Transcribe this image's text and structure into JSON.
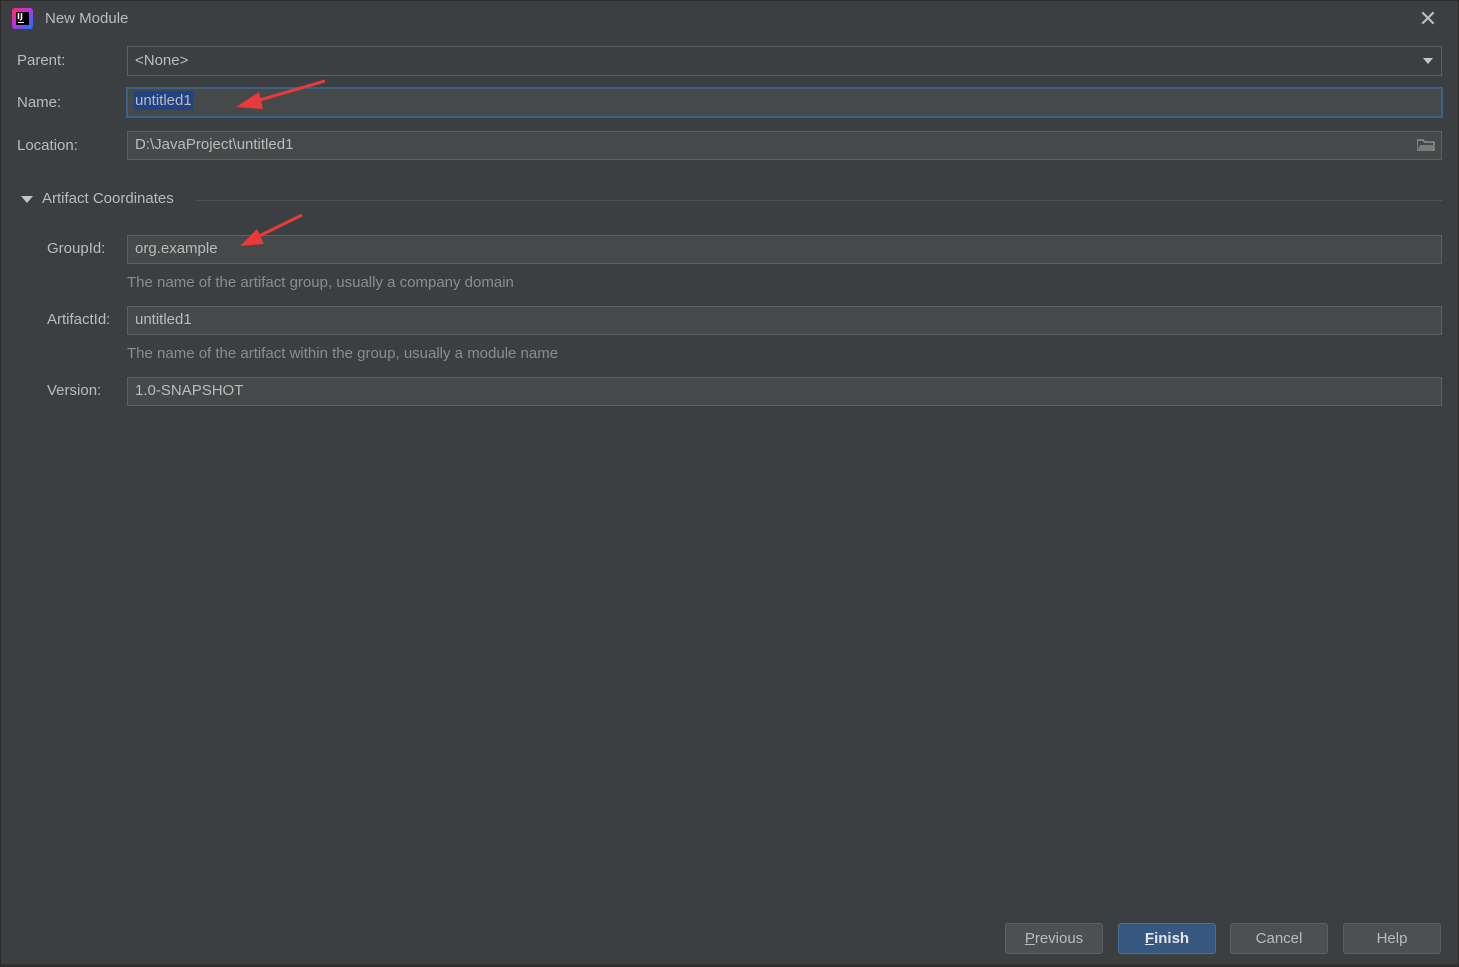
{
  "window": {
    "title": "New Module",
    "app_icon": "intellij-idea-icon",
    "close_glyph": "✕"
  },
  "form": {
    "parent": {
      "label": "Parent:",
      "value": "<None>"
    },
    "name": {
      "label": "Name:",
      "value": "untitled1"
    },
    "location": {
      "label": "Location:",
      "value": "D:\\JavaProject\\untitled1"
    }
  },
  "artifact": {
    "section_title": "Artifact Coordinates",
    "group_id": {
      "label": "GroupId:",
      "value": "org.example",
      "hint": "The name of the artifact group, usually a company domain"
    },
    "artifact_id": {
      "label": "ArtifactId:",
      "value": "untitled1",
      "hint": "The name of the artifact within the group, usually a module name"
    },
    "version": {
      "label": "Version:",
      "value": "1.0-SNAPSHOT"
    }
  },
  "buttons": {
    "previous": {
      "mnemonic": "P",
      "rest": "revious"
    },
    "finish": {
      "mnemonic": "F",
      "rest": "inish"
    },
    "cancel": "Cancel",
    "help": "Help"
  },
  "colors": {
    "background": "#3c3f41",
    "field_bg": "#45494a",
    "focus_border": "#3d6185",
    "selection": "#214283",
    "default_button": "#365880",
    "annotation_arrow": "#e83a3a"
  }
}
